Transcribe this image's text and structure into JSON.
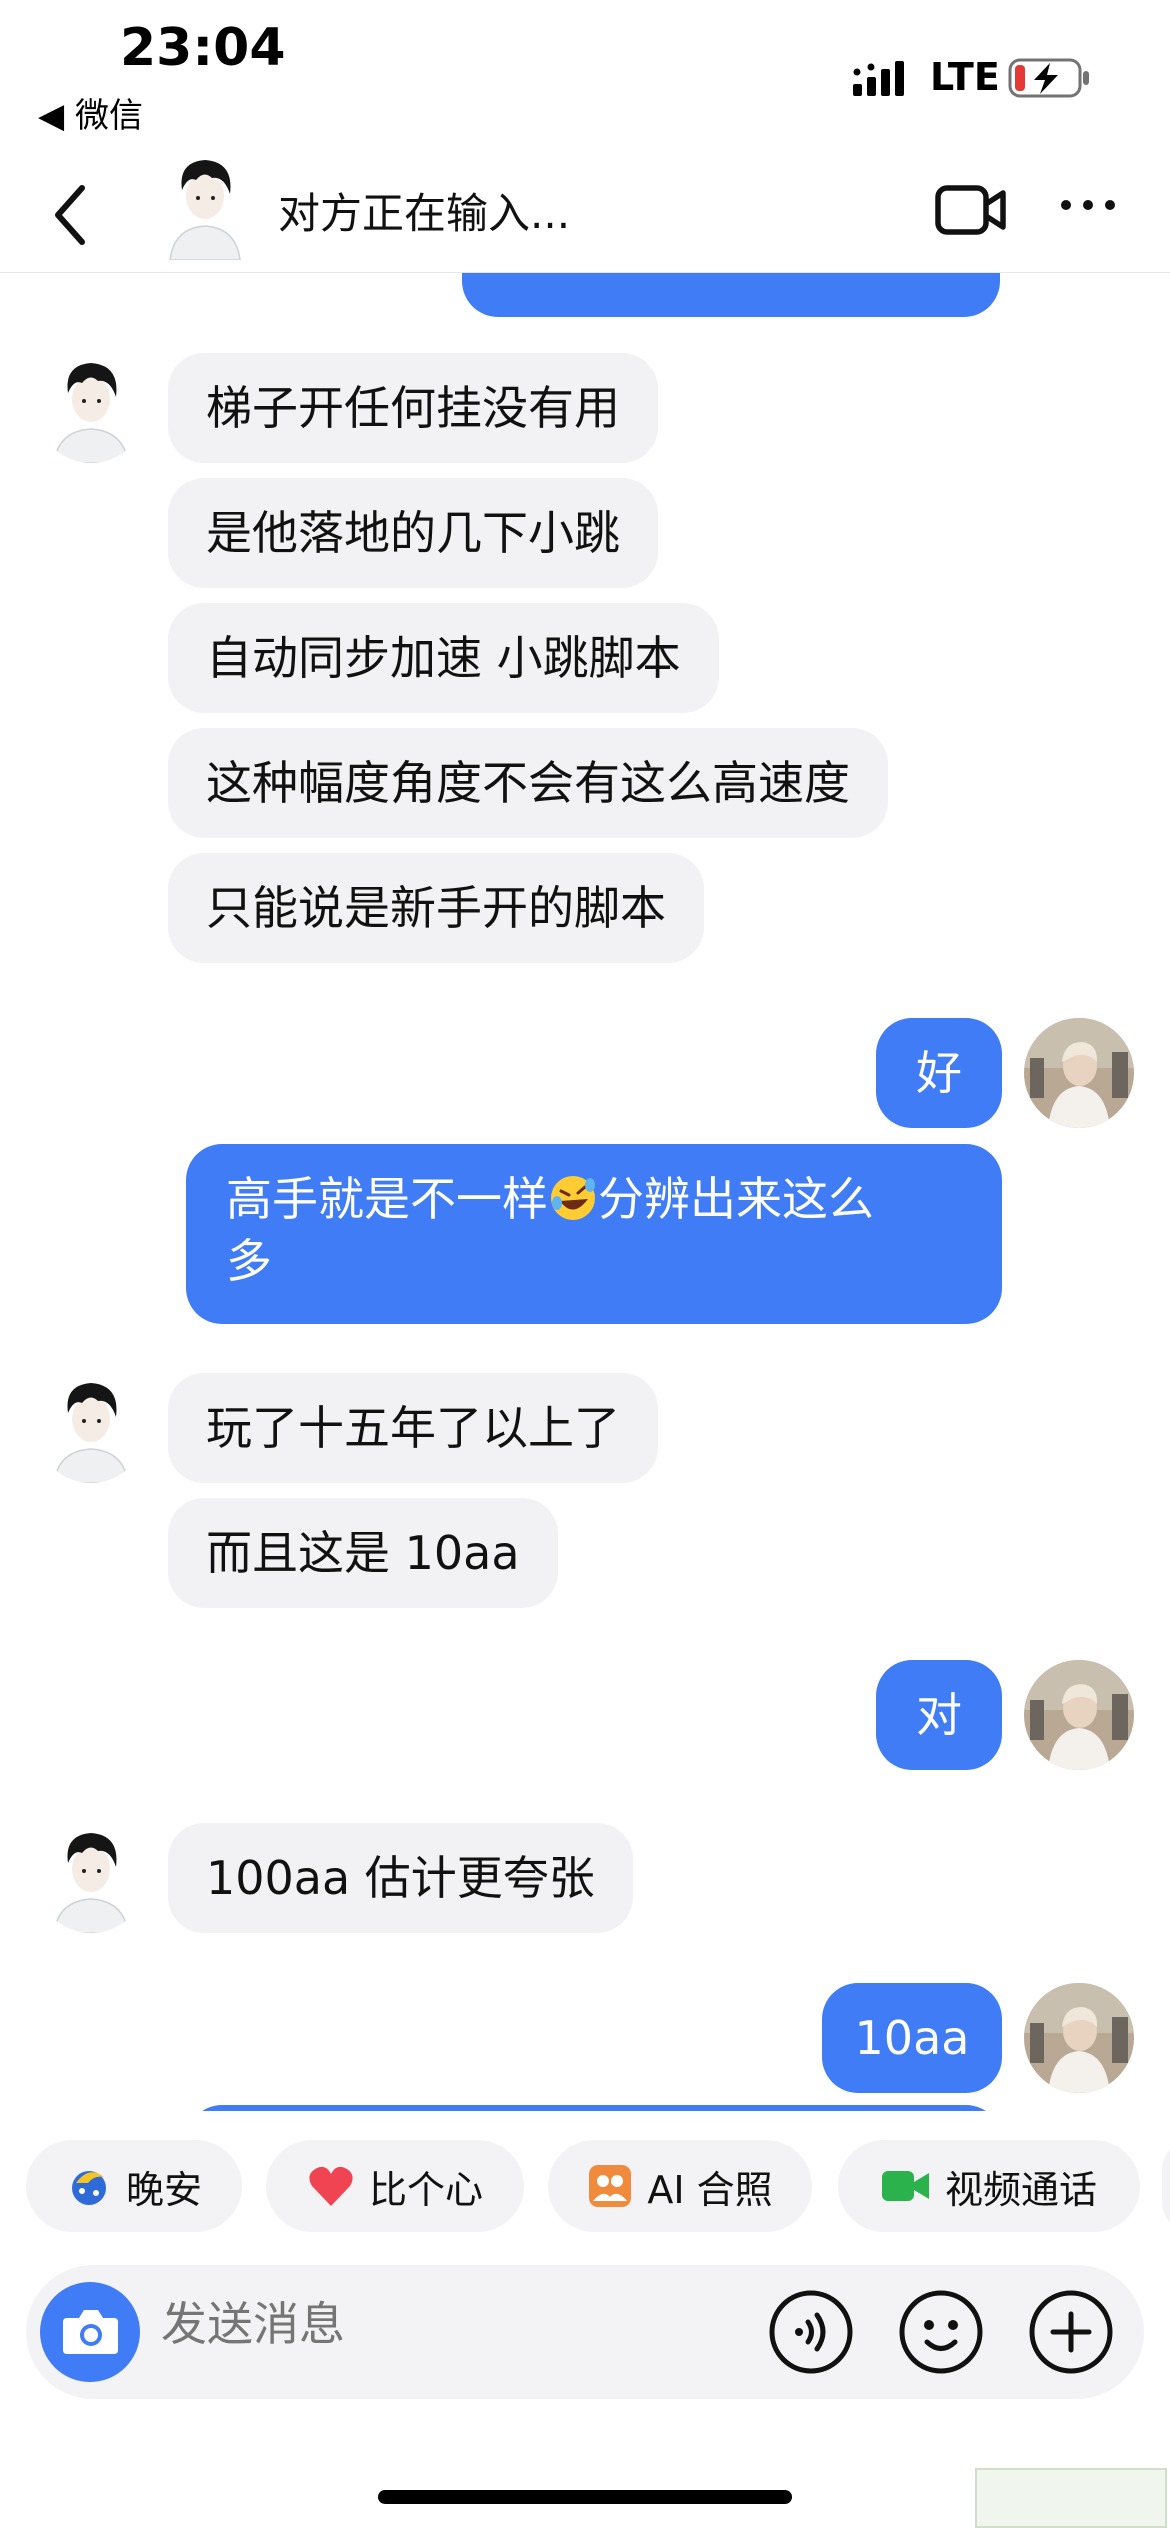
{
  "status_bar": {
    "time": "23:04",
    "back_app": "◀ 微信",
    "network": "LTE",
    "battery_state": "low-charging",
    "battery_color": "#e53935"
  },
  "header": {
    "title": "对方正在输入...",
    "back_icon": "chevron-left-icon",
    "video_icon": "video-camera-icon",
    "more_icon": "more-dots-icon"
  },
  "messages": [
    {
      "side": "in",
      "text": "梯子开任何挂没有用"
    },
    {
      "side": "in",
      "text": "是他落地的几下小跳"
    },
    {
      "side": "in",
      "text": "自动同步加速 小跳脚本"
    },
    {
      "side": "in",
      "text": "这种幅度角度不会有这么高速度"
    },
    {
      "side": "in",
      "text": "只能说是新手开的脚本"
    },
    {
      "side": "out",
      "text": "好"
    },
    {
      "side": "out",
      "text_part1": "高手就是不一样",
      "emoji": "rolling-on-floor-laughing-emoji",
      "text_part2": "分辨出来这么",
      "text_line2": "多"
    },
    {
      "side": "in",
      "text": "玩了十五年了以上了"
    },
    {
      "side": "in",
      "text": "而且这是 10aa"
    },
    {
      "side": "out",
      "text": "对"
    },
    {
      "side": "in",
      "text": "100aa 估计更夸张"
    },
    {
      "side": "out",
      "text": "10aa"
    }
  ],
  "quick_actions": [
    {
      "label": "晚安",
      "icon": "moon-icon"
    },
    {
      "label": "比个心",
      "icon": "heart-icon"
    },
    {
      "label": "AI 合照",
      "icon": "ai-photo-icon"
    },
    {
      "label": "视频通话",
      "icon": "video-call-icon"
    }
  ],
  "input": {
    "placeholder": "发送消息",
    "camera_icon": "camera-icon",
    "voice_icon": "voice-icon",
    "emoji_icon": "emoji-icon",
    "plus_icon": "plus-icon"
  },
  "colors": {
    "outgoing_bubble": "#3f7cf5",
    "incoming_bubble": "#f2f2f4",
    "accent": "#3f7cf5"
  }
}
